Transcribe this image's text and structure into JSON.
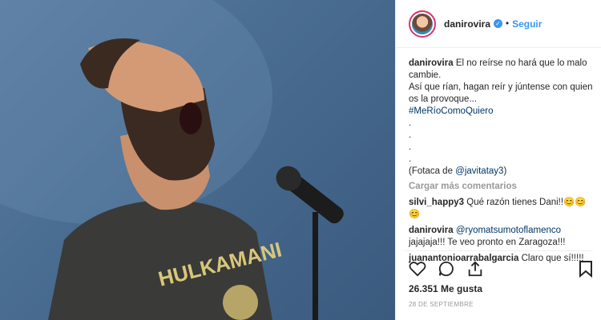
{
  "header": {
    "username": "danirovira",
    "verified_icon": "verified-badge-icon",
    "separator": "•",
    "follow_label": "Seguir"
  },
  "caption": {
    "username": "danirovira",
    "line1": "El no reírse no hará que lo malo cambie.",
    "line2": "Así que rían, hagan reír y júntense con quien os la provoque...",
    "hashtag": "#MeRíoComoQuiero",
    "dots": [
      ".",
      ".",
      ".",
      "."
    ],
    "credit_prefix": "(Fotaca de ",
    "credit_mention": "@javitatay3",
    "credit_suffix": ")"
  },
  "load_more": "Cargar más comentarios",
  "comments": [
    {
      "user": "silvi_happy3",
      "text": "Qué razón tienes Dani!!😊😊😊"
    },
    {
      "user": "danirovira",
      "mention": "@ryomatsumotoflamenco",
      "text": "jajajaja!!! Te veo pronto en Zaragoza!!!"
    },
    {
      "user": "juanantonioarrabalgarcia",
      "text": "Claro que sí!!!!!"
    }
  ],
  "actions": {
    "like_icon": "heart-icon",
    "comment_icon": "comment-icon",
    "share_icon": "share-icon",
    "save_icon": "bookmark-icon"
  },
  "likes": "26.351 Me gusta",
  "date": "28 DE SEPTIEMBRE",
  "photo": {
    "shirt_text": "HULKAMANI"
  },
  "colors": {
    "link_blue": "#3897f0",
    "hashtag_blue": "#003569",
    "muted": "#999999",
    "background_blue": "#4a6d92"
  }
}
